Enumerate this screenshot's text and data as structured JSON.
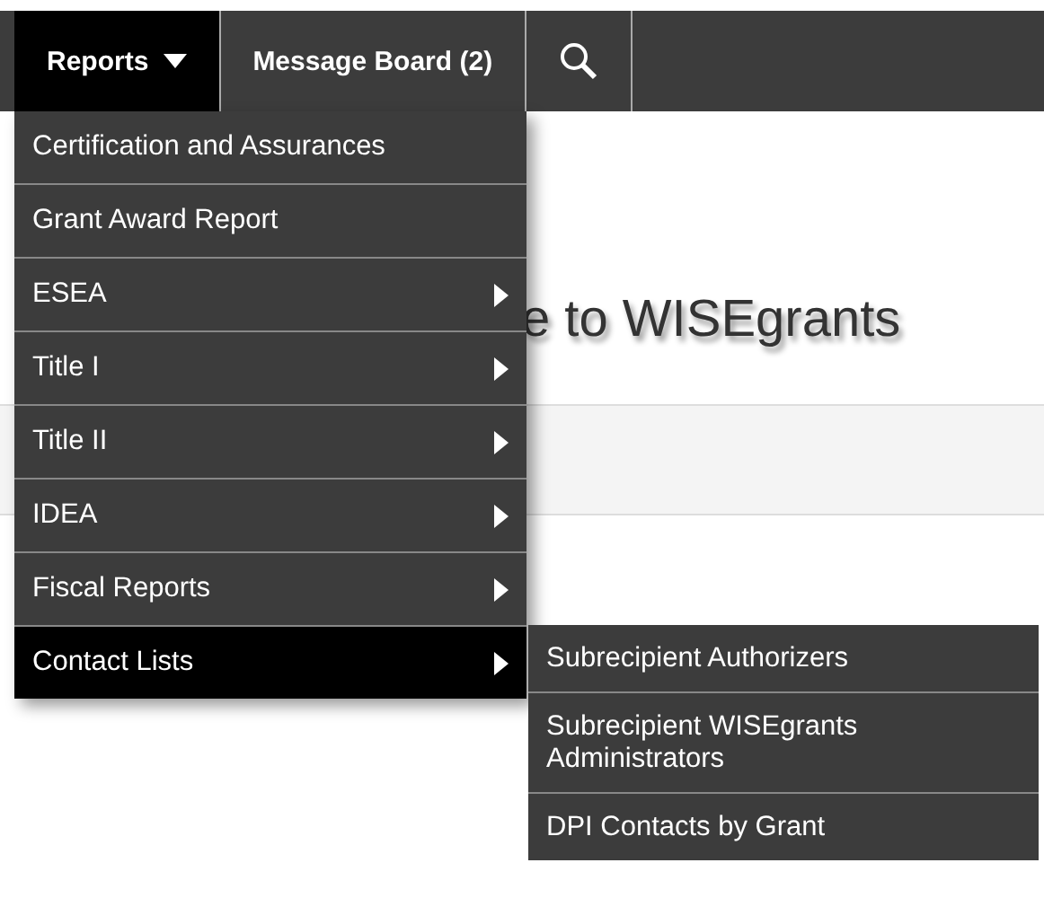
{
  "navbar": {
    "tabs": [
      {
        "label": "Reports",
        "kind": "dropdown",
        "selected": true
      },
      {
        "label": "Message Board (2)",
        "kind": "link",
        "selected": false
      },
      {
        "kind": "search",
        "selected": false
      }
    ]
  },
  "page": {
    "heading": "e to WISEgrants"
  },
  "menu": {
    "items": [
      {
        "label": "Certification and Assurances",
        "has_submenu": false,
        "selected": false
      },
      {
        "label": "Grant Award Report",
        "has_submenu": false,
        "selected": false
      },
      {
        "label": "ESEA",
        "has_submenu": true,
        "selected": false
      },
      {
        "label": "Title I",
        "has_submenu": true,
        "selected": false
      },
      {
        "label": "Title II",
        "has_submenu": true,
        "selected": false
      },
      {
        "label": "IDEA",
        "has_submenu": true,
        "selected": false
      },
      {
        "label": "Fiscal Reports",
        "has_submenu": true,
        "selected": false
      },
      {
        "label": "Contact Lists",
        "has_submenu": true,
        "selected": true,
        "children": [
          {
            "label": "Subrecipient Authorizers"
          },
          {
            "label": "Subrecipient WISEgrants Administrators"
          },
          {
            "label": "DPI Contacts by Grant"
          }
        ]
      }
    ]
  }
}
